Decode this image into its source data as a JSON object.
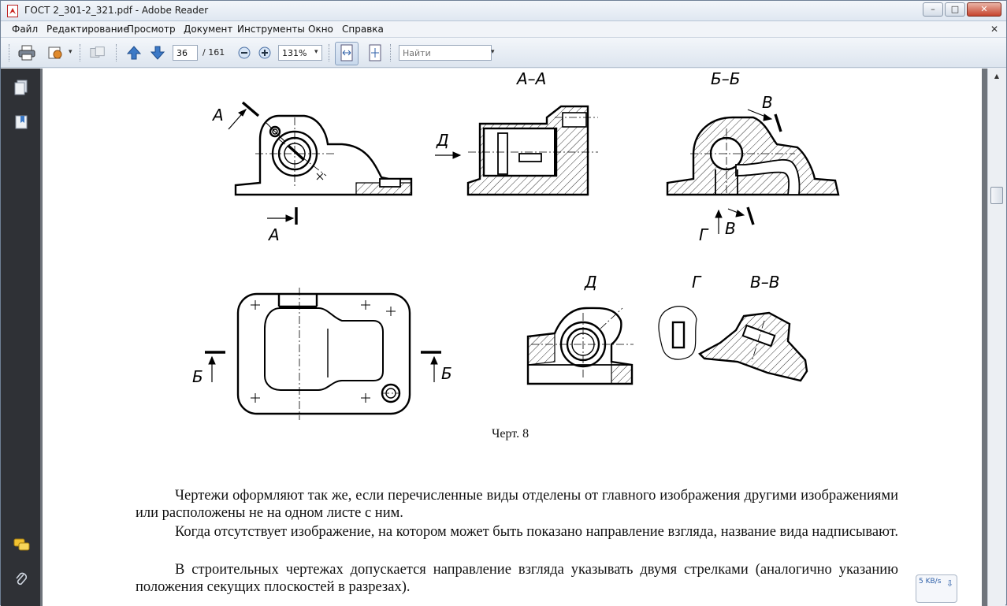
{
  "window": {
    "title": "ГОСТ 2_301-2_321.pdf - Adobe Reader",
    "buttons": [
      "–",
      "□",
      "✕"
    ]
  },
  "menu": {
    "items": [
      "Файл",
      "Редактирование",
      "Просмотр",
      "Документ",
      "Инструменты",
      "Окно",
      "Справка"
    ],
    "close": "✕"
  },
  "toolbar": {
    "page_current": "36",
    "page_total": "/ 161",
    "zoom": "131%",
    "search_placeholder": "Найти",
    "icons": [
      "print-icon",
      "email-icon",
      "collaborate-icon",
      "prev-page-icon",
      "next-page-icon",
      "zoom-out-icon",
      "zoom-in-icon",
      "fit-width-icon",
      "fit-page-icon"
    ]
  },
  "leftpanel": {
    "icons": [
      "pages-icon",
      "bookmarks-icon",
      "comments-icon",
      "attachments-icon"
    ]
  },
  "drawing": {
    "labels": {
      "section_aa": "А–А",
      "section_bb": "Б–Б",
      "arrow_a_top": "А",
      "arrow_a_bottom": "А",
      "arrow_d": "Д",
      "arrow_v_top": "В",
      "arrow_v_bottom": "В",
      "arrow_g": "Г",
      "arrow_b_left": "Б",
      "arrow_b_right": "Б",
      "view_d": "Д",
      "view_g": "Г",
      "section_vv": "В–В"
    }
  },
  "document": {
    "caption": "Черт. 8",
    "paragraphs": [
      "Чертежи оформляют так же, если перечисленные виды отделены от главного изображения другими изображениями или расположены не на одном листе с ним.",
      "Когда отсутствует изображение, на котором может быть показано направление взгляда, название вида надписывают.",
      "В строительных чертежах допускается направление взгляда указывать двумя стрелками (аналогично указанию положения секущих плоскостей в разрезах)."
    ]
  },
  "status": {
    "net_speed": "5 KB/s"
  }
}
